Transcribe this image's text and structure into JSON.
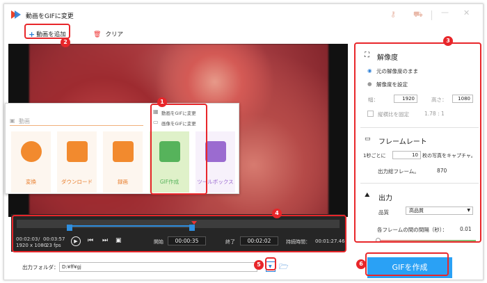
{
  "window": {
    "title": "動画をGIFに変更"
  },
  "toolbar": {
    "add_label": "動画を追加",
    "clear_label": "クリア"
  },
  "popup": {
    "header": "動画",
    "menu": [
      "動画をGIFに変更",
      "画像をGIFに変更"
    ],
    "tiles": [
      {
        "label": "変換",
        "color": "#f28a2e"
      },
      {
        "label": "ダウンロード",
        "color": "#f28a2e"
      },
      {
        "label": "録画",
        "color": "#f28a2e"
      },
      {
        "label": "GIF作成",
        "color": "#56b35b"
      },
      {
        "label": "ツールボックス",
        "color": "#9b6bd0"
      }
    ]
  },
  "player": {
    "current": "00:02:03",
    "total": "00:03:57",
    "sep": "/",
    "resolution": "1920 x 1080",
    "fps": "23 fps",
    "start_label": "開始",
    "start": "00:00:35",
    "end_label": "終了",
    "end": "00:02:02",
    "duration_label": "持続時間：",
    "duration": "00:01:27.46"
  },
  "panel": {
    "resolution_title": "解像度",
    "keep_original": "元の解像度のまま",
    "set_resolution": "解像度を設定",
    "width_label": "幅：",
    "width": "1920",
    "height_label": "高さ：",
    "height": "1080",
    "aspect_label": "縦横比を固定",
    "aspect_value": "1.78 : 1",
    "framerate_title": "フレームレート",
    "per_sec_label": "1秒ごとに",
    "per_sec_value": "10",
    "per_sec_suffix": "枚の写真をキャプチャ。",
    "total_frames_label": "出力総フレーム。",
    "total_frames": "870",
    "output_title": "出力",
    "quality_label": "品質",
    "quality": "高品質",
    "interval_label": "各フレームの間の間隔（秒）：",
    "interval": "0.01"
  },
  "bottom": {
    "folder_label": "出力フォルダ：",
    "folder_path": "D:¥ff¥gj",
    "make_gif": "GIFを作成"
  },
  "badges": [
    "1",
    "2",
    "3",
    "4",
    "5",
    "6"
  ],
  "colors": {
    "accent": "#2aa1f5",
    "annotation": "#e8262a"
  }
}
